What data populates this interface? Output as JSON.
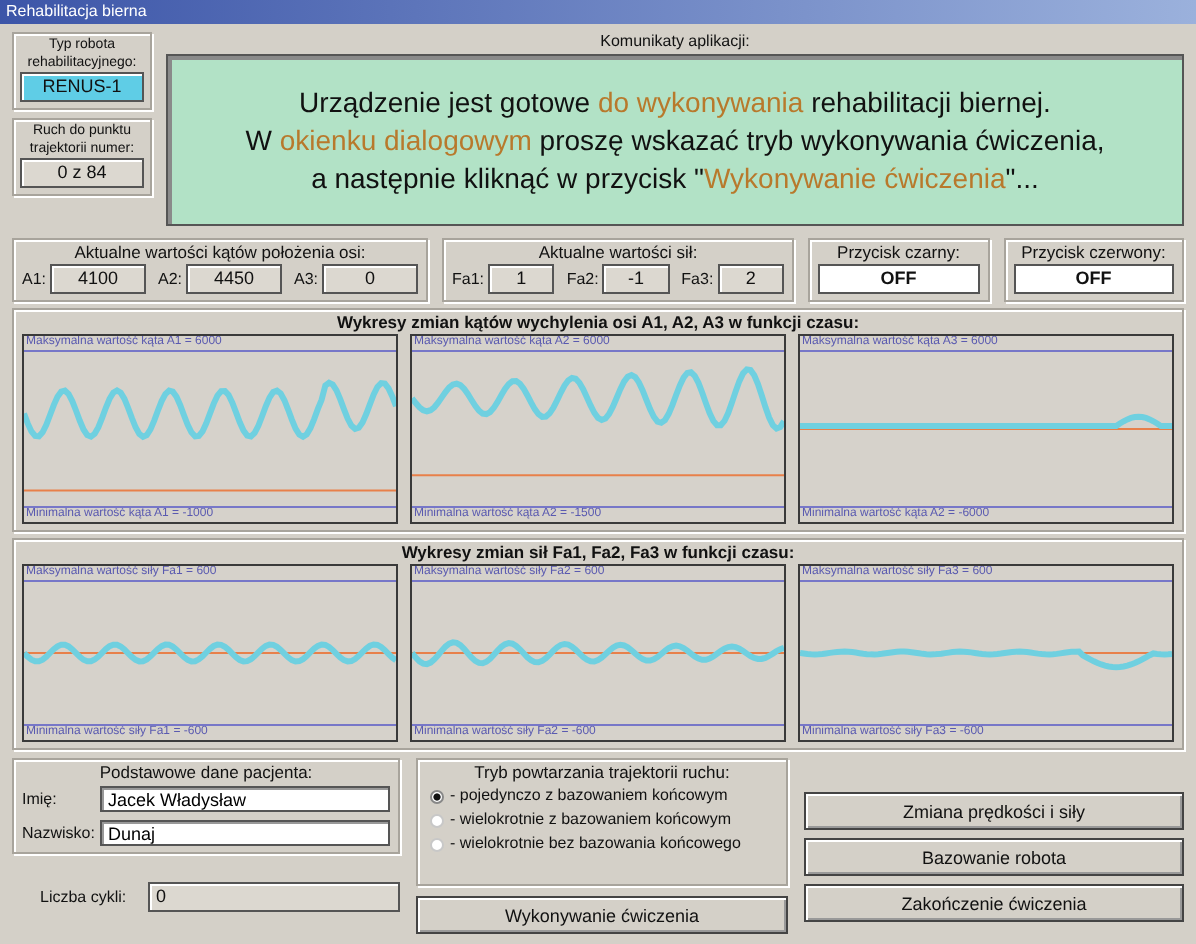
{
  "window": {
    "title": "Rehabilitacja bierna"
  },
  "robot_type": {
    "label": "Typ robota rehabilitacyjnego:",
    "value": "RENUS-1"
  },
  "trajectory_point": {
    "label": "Ruch do punktu trajektorii numer:",
    "value": "0 z 84"
  },
  "messages": {
    "title": "Komunikaty aplikacji:",
    "lines": [
      [
        {
          "text": "Urządzenie jest gotowe ",
          "highlight": false
        },
        {
          "text": "do wykonywania",
          "highlight": true
        },
        {
          "text": " rehabilitacji biernej.",
          "highlight": false
        }
      ],
      [
        {
          "text": "W ",
          "highlight": false
        },
        {
          "text": "okienku dialogowym",
          "highlight": true
        },
        {
          "text": " proszę wskazać tryb wykonywania ćwiczenia,",
          "highlight": false
        }
      ],
      [
        {
          "text": "a następnie kliknąć w przycisk \"",
          "highlight": false
        },
        {
          "text": "Wykonywanie ćwiczenia",
          "highlight": true
        },
        {
          "text": "\"...",
          "highlight": false
        }
      ]
    ]
  },
  "angles": {
    "title": "Aktualne wartości kątów położenia osi:",
    "items": [
      {
        "label": "A1:",
        "value": "4100"
      },
      {
        "label": "A2:",
        "value": "4450"
      },
      {
        "label": "A3:",
        "value": "0"
      }
    ]
  },
  "forces": {
    "title": "Aktualne wartości sił:",
    "items": [
      {
        "label": "Fa1:",
        "value": "1"
      },
      {
        "label": "Fa2:",
        "value": "-1"
      },
      {
        "label": "Fa3:",
        "value": "2"
      }
    ]
  },
  "switches": [
    {
      "label": "Przycisk czarny:",
      "value": "OFF"
    },
    {
      "label": "Przycisk czerwony:",
      "value": "OFF"
    }
  ],
  "angle_charts": {
    "title": "Wykresy zmian kątów wychylenia osi A1, A2, A3 w funkcji czasu:",
    "panels": [
      {
        "max_label": "Maksymalna wartość kąta A1 = 6000",
        "min_label": "Minimalna wartość kąta A1 = -1000"
      },
      {
        "max_label": "Maksymalna wartość kąta A2 = 6000",
        "min_label": "Minimalna wartość kąta A2 = -1500"
      },
      {
        "max_label": "Maksymalna wartość kąta A3 = 6000",
        "min_label": "Minimalna wartość kąta A2 = -6000"
      }
    ]
  },
  "force_charts": {
    "title": "Wykresy zmian sił Fa1, Fa2, Fa3 w funkcji czasu:",
    "panels": [
      {
        "max_label": "Maksymalna wartość siły Fa1 = 600",
        "min_label": "Minimalna wartość siły Fa1 = -600"
      },
      {
        "max_label": "Maksymalna wartość siły Fa2 = 600",
        "min_label": "Minimalna wartość siły Fa2 = -600"
      },
      {
        "max_label": "Maksymalna wartość siły Fa3 = 600",
        "min_label": "Minimalna wartość siły Fa3 = -600"
      }
    ]
  },
  "patient": {
    "title": "Podstawowe dane pacjenta:",
    "fields": [
      {
        "label": "Imię:",
        "value": "Jacek Władysław"
      },
      {
        "label": "Nazwisko:",
        "value": "Dunaj"
      }
    ]
  },
  "cycles": {
    "label": "Liczba cykli:",
    "value": "0"
  },
  "repeat_mode": {
    "title": "Tryb powtarzania trajektorii ruchu:",
    "options": [
      {
        "label": "- pojedynczo z bazowaniem końcowym",
        "selected": true
      },
      {
        "label": "- wielokrotnie z bazowaniem końcowym",
        "selected": false
      },
      {
        "label": "- wielokrotnie bez bazowania końcowego",
        "selected": false
      }
    ]
  },
  "buttons": {
    "run": "Wykonywanie ćwiczenia",
    "speed": "Zmiana prędkości i siły",
    "homing": "Bazowanie robota",
    "finish": "Zakończenie ćwiczenia"
  }
}
